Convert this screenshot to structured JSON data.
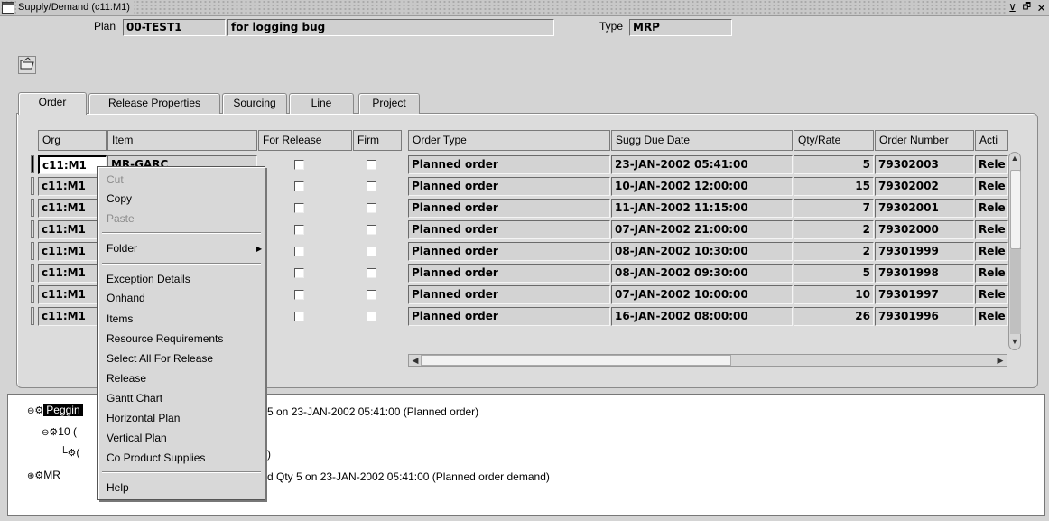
{
  "window": {
    "title": "Supply/Demand (c11:M1)",
    "controls": [
      "⊻",
      "🗗",
      "✕"
    ]
  },
  "header": {
    "plan_label": "Plan",
    "plan_value": "00-TEST1",
    "plan_desc": "for logging bug",
    "type_label": "Type",
    "type_value": "MRP"
  },
  "tabs": [
    {
      "label": "Order",
      "active": true
    },
    {
      "label": "Release Properties"
    },
    {
      "label": "Sourcing"
    },
    {
      "label": "Line"
    },
    {
      "label": "Project"
    }
  ],
  "grid": {
    "columns": [
      "Org",
      "Item",
      "For Release",
      "Firm",
      "Order Type",
      "Sugg Due Date",
      "Qty/Rate",
      "Order Number",
      "Acti"
    ],
    "rows": [
      {
        "org": "c11:M1",
        "item": "MR-GARC",
        "order_type": "Planned order",
        "due": "23-JAN-2002 05:41:00",
        "qty": "5",
        "order_no": "79302003",
        "action": "Rele"
      },
      {
        "org": "c11:M1",
        "item": "",
        "order_type": "Planned order",
        "due": "10-JAN-2002 12:00:00",
        "qty": "15",
        "order_no": "79302002",
        "action": "Rele"
      },
      {
        "org": "c11:M1",
        "item": "",
        "order_type": "Planned order",
        "due": "11-JAN-2002 11:15:00",
        "qty": "7",
        "order_no": "79302001",
        "action": "Rele"
      },
      {
        "org": "c11:M1",
        "item": "",
        "order_type": "Planned order",
        "due": "07-JAN-2002 21:00:00",
        "qty": "2",
        "order_no": "79302000",
        "action": "Rele"
      },
      {
        "org": "c11:M1",
        "item": "",
        "order_type": "Planned order",
        "due": "08-JAN-2002 10:30:00",
        "qty": "2",
        "order_no": "79301999",
        "action": "Rele"
      },
      {
        "org": "c11:M1",
        "item": "",
        "order_type": "Planned order",
        "due": "08-JAN-2002 09:30:00",
        "qty": "5",
        "order_no": "79301998",
        "action": "Rele"
      },
      {
        "org": "c11:M1",
        "item": "",
        "order_type": "Planned order",
        "due": "07-JAN-2002 10:00:00",
        "qty": "10",
        "order_no": "79301997",
        "action": "Rele"
      },
      {
        "org": "c11:M1",
        "item": "",
        "order_type": "Planned order",
        "due": "16-JAN-2002 08:00:00",
        "qty": "26",
        "order_no": "79301996",
        "action": "Rele"
      }
    ]
  },
  "tree": {
    "line1_node": "Peggin",
    "line1_rest": "5 on 23-JAN-2002 05:41:00 (Planned order)",
    "line2": "10 (",
    "line3_prefix": "(",
    "line3_suffix": ")",
    "line4_node": "MR",
    "line4_rest": "d Qty 5 on 23-JAN-2002 05:41:00 (Planned order demand)"
  },
  "context_menu": {
    "cut": "Cut",
    "copy": "Copy",
    "paste": "Paste",
    "folder": "Folder",
    "exception_details": "Exception Details",
    "onhand": "Onhand",
    "items": "Items",
    "resource_requirements": "Resource Requirements",
    "select_all_for_release": "Select All For Release",
    "release": "Release",
    "gantt_chart": "Gantt Chart",
    "horizontal_plan": "Horizontal Plan",
    "vertical_plan": "Vertical Plan",
    "co_product_supplies": "Co Product Supplies",
    "help": "Help"
  }
}
